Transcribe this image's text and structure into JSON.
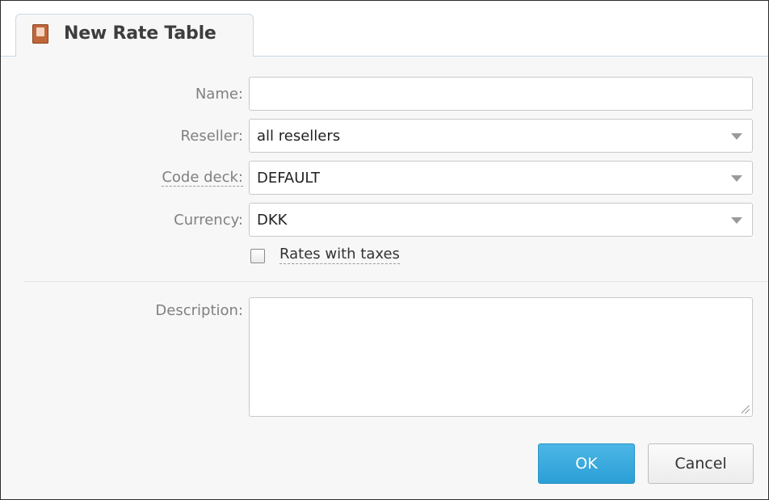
{
  "dialog": {
    "tab_title": "New Rate Table",
    "tab_icon": "book-icon"
  },
  "form": {
    "name_label": "Name:",
    "name_value": "",
    "reseller_label": "Reseller:",
    "reseller_value": "all resellers",
    "code_deck_label": "Code deck:",
    "code_deck_value": "DEFAULT",
    "currency_label": "Currency:",
    "currency_value": "DKK",
    "rates_with_taxes_label": "Rates with taxes",
    "rates_with_taxes_checked": false,
    "description_label": "Description:",
    "description_value": ""
  },
  "buttons": {
    "ok_label": "OK",
    "cancel_label": "Cancel"
  },
  "colors": {
    "accent": "#2b9fd6",
    "tab_icon": "#c0673a"
  }
}
